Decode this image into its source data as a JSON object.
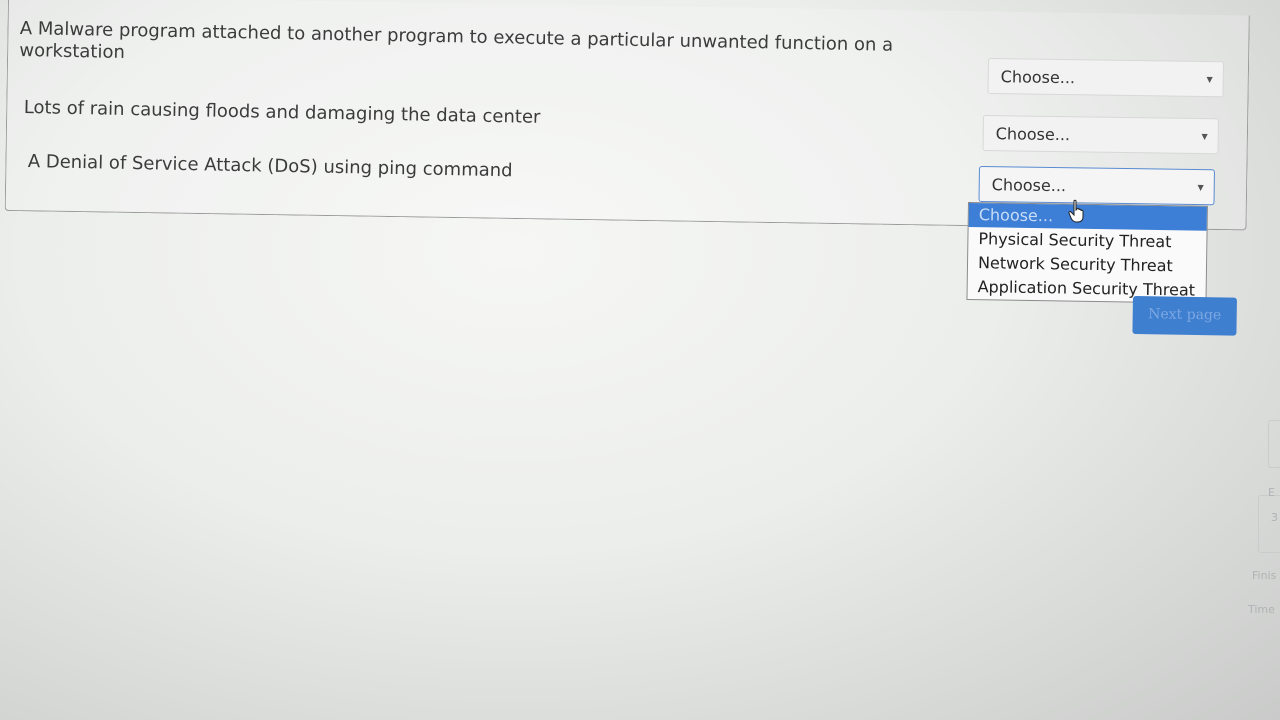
{
  "questions": [
    {
      "text": "A Malware program attached to another program to execute a particular unwanted function on a workstation",
      "answer": "Choose..."
    },
    {
      "text": "Lots of rain causing floods and damaging the data center",
      "answer": "Choose..."
    },
    {
      "text": "A Denial of Service Attack (DoS) using ping command",
      "answer": "Choose..."
    }
  ],
  "dropdown": {
    "options": [
      "Choose...",
      "Physical Security Threat",
      "Network Security Threat",
      "Application Security Threat"
    ],
    "selected_index": 0
  },
  "next_button": "Next page",
  "edge_labels": {
    "a": "E",
    "b": "3",
    "finish": "Finis",
    "time": "Time"
  },
  "colors": {
    "accent": "#3d7fd6",
    "button": "#3f7fd0"
  }
}
